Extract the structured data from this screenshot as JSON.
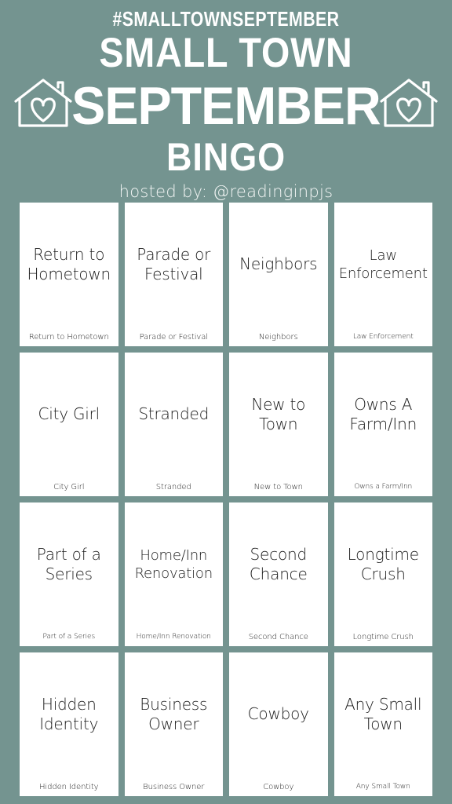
{
  "theme": {
    "background_color": "#749490",
    "cell_color": "#ffffff",
    "header_text_color": "#ffffff",
    "cell_text_color": "#1c1c1c"
  },
  "header": {
    "hashtag": "#SMALLTOWNSEPTEMBER",
    "title_line1": "SMALL TOWN",
    "title_line2": "SEPTEMBER",
    "title_line3": "BINGO",
    "hosted_by": "hosted by: @readinginpjs",
    "icon_left": "house-heart-icon",
    "icon_right": "house-heart-icon"
  },
  "grid": {
    "columns": 4,
    "rows": 4,
    "cells": [
      {
        "label": "Return to Hometown",
        "caption": "Return to Hometown"
      },
      {
        "label": "Parade or Festival",
        "caption": "Parade or Festival"
      },
      {
        "label": "Neighbors",
        "caption": "Neighbors"
      },
      {
        "label": "Law Enforcement",
        "caption": "Law Enforcement"
      },
      {
        "label": "City Girl",
        "caption": "City Girl"
      },
      {
        "label": "Stranded",
        "caption": "Stranded"
      },
      {
        "label": "New to Town",
        "caption": "New to Town"
      },
      {
        "label": "Owns A Farm/Inn",
        "caption": "Owns a Farm/Inn"
      },
      {
        "label": "Part of a Series",
        "caption": "Part of a Series"
      },
      {
        "label": "Home/Inn Renovation",
        "caption": "Home/Inn Renovation"
      },
      {
        "label": "Second Chance",
        "caption": "Second Chance"
      },
      {
        "label": "Longtime Crush",
        "caption": "Longtime Crush"
      },
      {
        "label": "Hidden Identity",
        "caption": "Hidden Identity"
      },
      {
        "label": "Business Owner",
        "caption": "Business Owner"
      },
      {
        "label": "Cowboy",
        "caption": "Cowboy"
      },
      {
        "label": "Any Small Town",
        "caption": "Any Small Town"
      }
    ]
  }
}
